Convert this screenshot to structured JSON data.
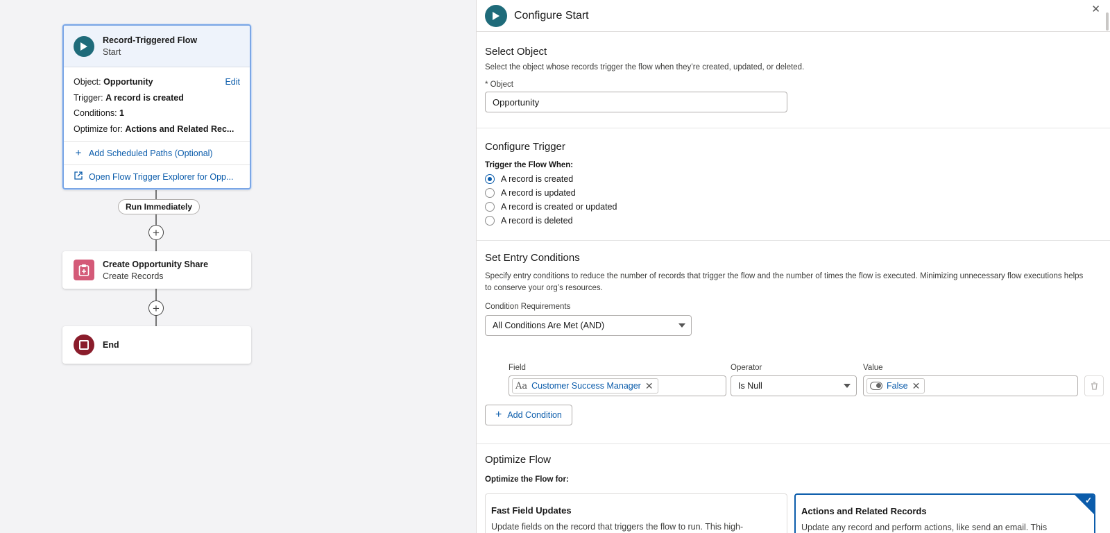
{
  "flow": {
    "start": {
      "title": "Record-Triggered Flow",
      "subtitle": "Start",
      "object_label": "Object:",
      "object_value": "Opportunity",
      "edit_label": "Edit",
      "trigger_label": "Trigger:",
      "trigger_value": "A record is created",
      "conditions_label": "Conditions:",
      "conditions_value": "1",
      "optimize_label": "Optimize for:",
      "optimize_value": "Actions and Related Rec...",
      "scheduled_paths": "Add Scheduled Paths (Optional)",
      "explorer_link": "Open Flow Trigger Explorer for Opp..."
    },
    "run_pill": "Run Immediately",
    "create_node": {
      "title": "Create Opportunity Share",
      "subtitle": "Create Records"
    },
    "end_node": {
      "title": "End"
    }
  },
  "panel": {
    "title": "Configure Start",
    "select_object": {
      "title": "Select Object",
      "description": "Select the object whose records trigger the flow when they’re created, updated, or deleted.",
      "field_label": "* Object",
      "field_value": "Opportunity"
    },
    "configure_trigger": {
      "title": "Configure Trigger",
      "label": "Trigger the Flow When:",
      "options": [
        {
          "label": "A record is created",
          "selected": true
        },
        {
          "label": "A record is updated",
          "selected": false
        },
        {
          "label": "A record is created or updated",
          "selected": false
        },
        {
          "label": "A record is deleted",
          "selected": false
        }
      ]
    },
    "entry_conditions": {
      "title": "Set Entry Conditions",
      "description": "Specify entry conditions to reduce the number of records that trigger the flow and the number of times the flow is executed. Minimizing unnecessary flow executions helps to conserve your org’s resources.",
      "requirements_label": "Condition Requirements",
      "requirements_value": "All Conditions Are Met (AND)",
      "field_header": "Field",
      "operator_header": "Operator",
      "value_header": "Value",
      "condition": {
        "field": "Customer Success Manager",
        "operator": "Is Null",
        "value": "False"
      },
      "add_condition": "Add Condition"
    },
    "optimize": {
      "title": "Optimize Flow",
      "label": "Optimize the Flow for:",
      "cards": [
        {
          "title": "Fast Field Updates",
          "desc": "Update fields on the record that triggers the flow to run. This high-",
          "selected": false
        },
        {
          "title": "Actions and Related Records",
          "desc": "Update any record and perform actions, like send an email. This",
          "selected": true
        }
      ]
    }
  },
  "colors": {
    "accent": "#0b5cab",
    "start_icon": "#1f6b7a",
    "create_icon": "#d45a78",
    "end_icon": "#8a1c2b"
  }
}
